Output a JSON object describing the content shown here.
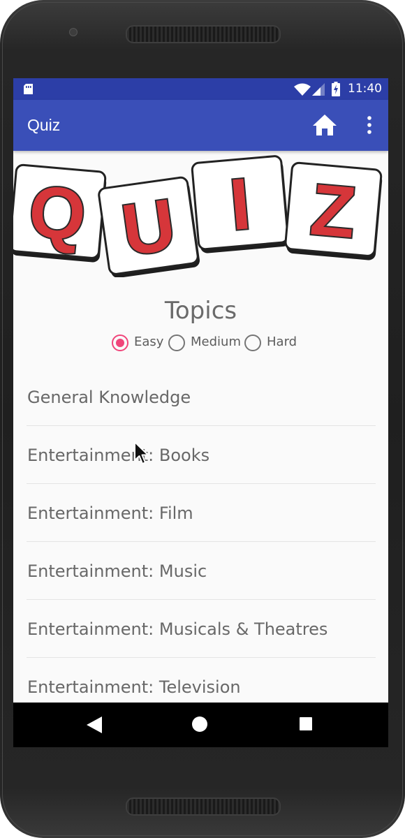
{
  "status_bar": {
    "time": "11:40",
    "icons": [
      "sim-card-icon",
      "wifi-icon",
      "signal-icon",
      "battery-charging-icon"
    ]
  },
  "app_bar": {
    "title": "Quiz",
    "actions": [
      "home-icon",
      "overflow-menu-icon"
    ],
    "background": "#3a4fb8",
    "status_background": "#2c3ea7"
  },
  "logo": {
    "letters": [
      "Q",
      "U",
      "I",
      "Z"
    ],
    "letter_color": "#d6363a"
  },
  "topics": {
    "heading": "Topics",
    "difficulty": {
      "options": [
        {
          "label": "Easy",
          "checked": true
        },
        {
          "label": "Medium",
          "checked": false
        },
        {
          "label": "Hard",
          "checked": false
        }
      ],
      "accent": "#f0457a"
    },
    "items": [
      "General Knowledge",
      "Entertainment: Books",
      "Entertainment: Film",
      "Entertainment: Music",
      "Entertainment: Musicals & Theatres",
      "Entertainment: Television"
    ]
  },
  "nav_bar": {
    "buttons": [
      "back-icon",
      "home-circle-icon",
      "recents-icon"
    ]
  }
}
